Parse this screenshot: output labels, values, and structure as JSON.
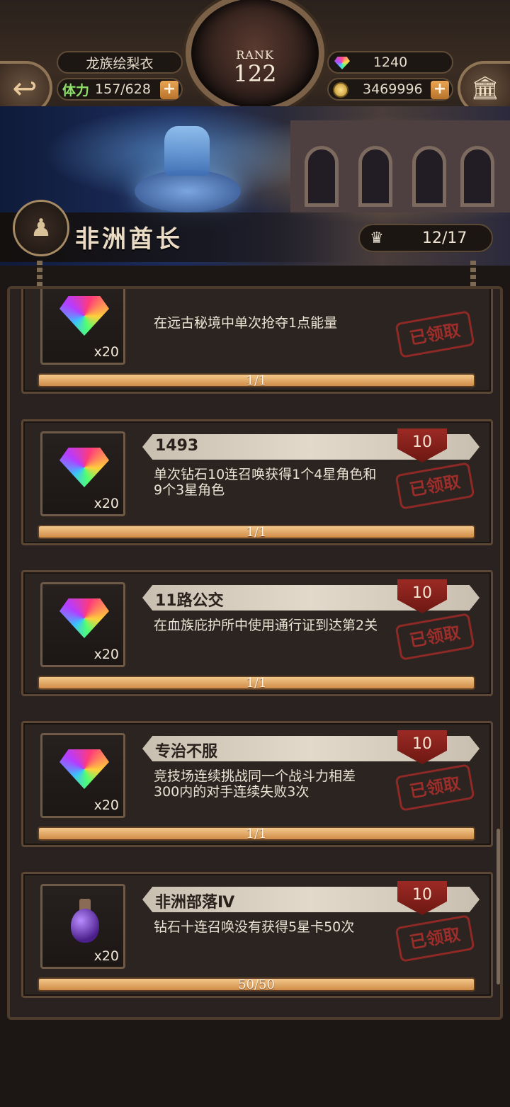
{
  "header": {
    "player_name": "龙族绘梨衣",
    "stamina_label": "体力",
    "stamina_value": "157/628",
    "rank_label": "RANK",
    "rank_value": "122",
    "gems": "1240",
    "gold": "3469996",
    "plus_symbol": "+"
  },
  "banner": {
    "title": "非洲酋长",
    "progress_count": "12/17"
  },
  "tasks": [
    {
      "name": "",
      "points": "",
      "description": "在远古秘境中单次抢夺1点能量",
      "reward_icon": "rainbow-gem-icon",
      "reward_qty": "x20",
      "status": "已领取",
      "progress": "1/1",
      "progress_fraction": 1
    },
    {
      "name": "1493",
      "points": "10",
      "description": "单次钻石10连召唤获得1个4星角色和9个3星角色",
      "reward_icon": "rainbow-gem-icon",
      "reward_qty": "x20",
      "status": "已领取",
      "progress": "1/1",
      "progress_fraction": 1
    },
    {
      "name": "11路公交",
      "points": "10",
      "description": "在血族庇护所中使用通行证到达第2关",
      "reward_icon": "rainbow-gem-icon",
      "reward_qty": "x20",
      "status": "已领取",
      "progress": "1/1",
      "progress_fraction": 1
    },
    {
      "name": "专治不服",
      "points": "10",
      "description": "竞技场连续挑战同一个战斗力相差300内的对手连续失败3次",
      "reward_icon": "rainbow-gem-icon",
      "reward_qty": "x20",
      "status": "已领取",
      "progress": "1/1",
      "progress_fraction": 1
    },
    {
      "name": "非洲部落Ⅳ",
      "points": "10",
      "description": "钻石十连召唤没有获得5星卡50次",
      "reward_icon": "purple-potion-icon",
      "reward_qty": "x20",
      "status": "已领取",
      "progress": "50/50",
      "progress_fraction": 1
    }
  ]
}
